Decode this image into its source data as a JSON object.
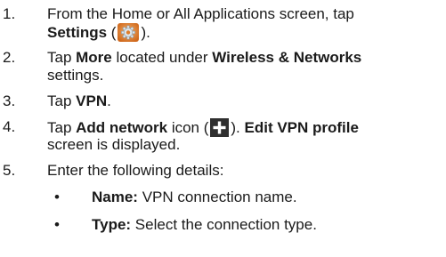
{
  "steps": [
    {
      "number": "1.",
      "line1_text": "From the Home or All Applications screen, tap",
      "line2_bold": "Settings",
      "line2_open": " (",
      "line2_close": ")."
    },
    {
      "number": "2.",
      "text_a": "Tap ",
      "bold_a": "More",
      "text_b": " located under ",
      "bold_b": "Wireless & Networks",
      "line2_text": "settings."
    },
    {
      "number": "3.",
      "text_a": "Tap ",
      "bold_a": "VPN",
      "text_b": "."
    },
    {
      "number": "4.",
      "text_a": "Tap ",
      "bold_a": "Add network",
      "text_b": " icon (",
      "text_c": "). ",
      "bold_b": "Edit VPN profile",
      "line2_text": "screen is displayed."
    },
    {
      "number": "5.",
      "text_a": "Enter the following details:"
    }
  ],
  "details": [
    {
      "bullet": "•",
      "label": "Name:",
      "text": " VPN connection name."
    },
    {
      "bullet": "•",
      "label": "Type:",
      "text": " Select the connection type."
    }
  ],
  "icons": {
    "settings_icon": "gear-icon",
    "add_icon": "plus-icon",
    "settings_color": "#e07d2a",
    "add_color": "#2f2f2f"
  }
}
